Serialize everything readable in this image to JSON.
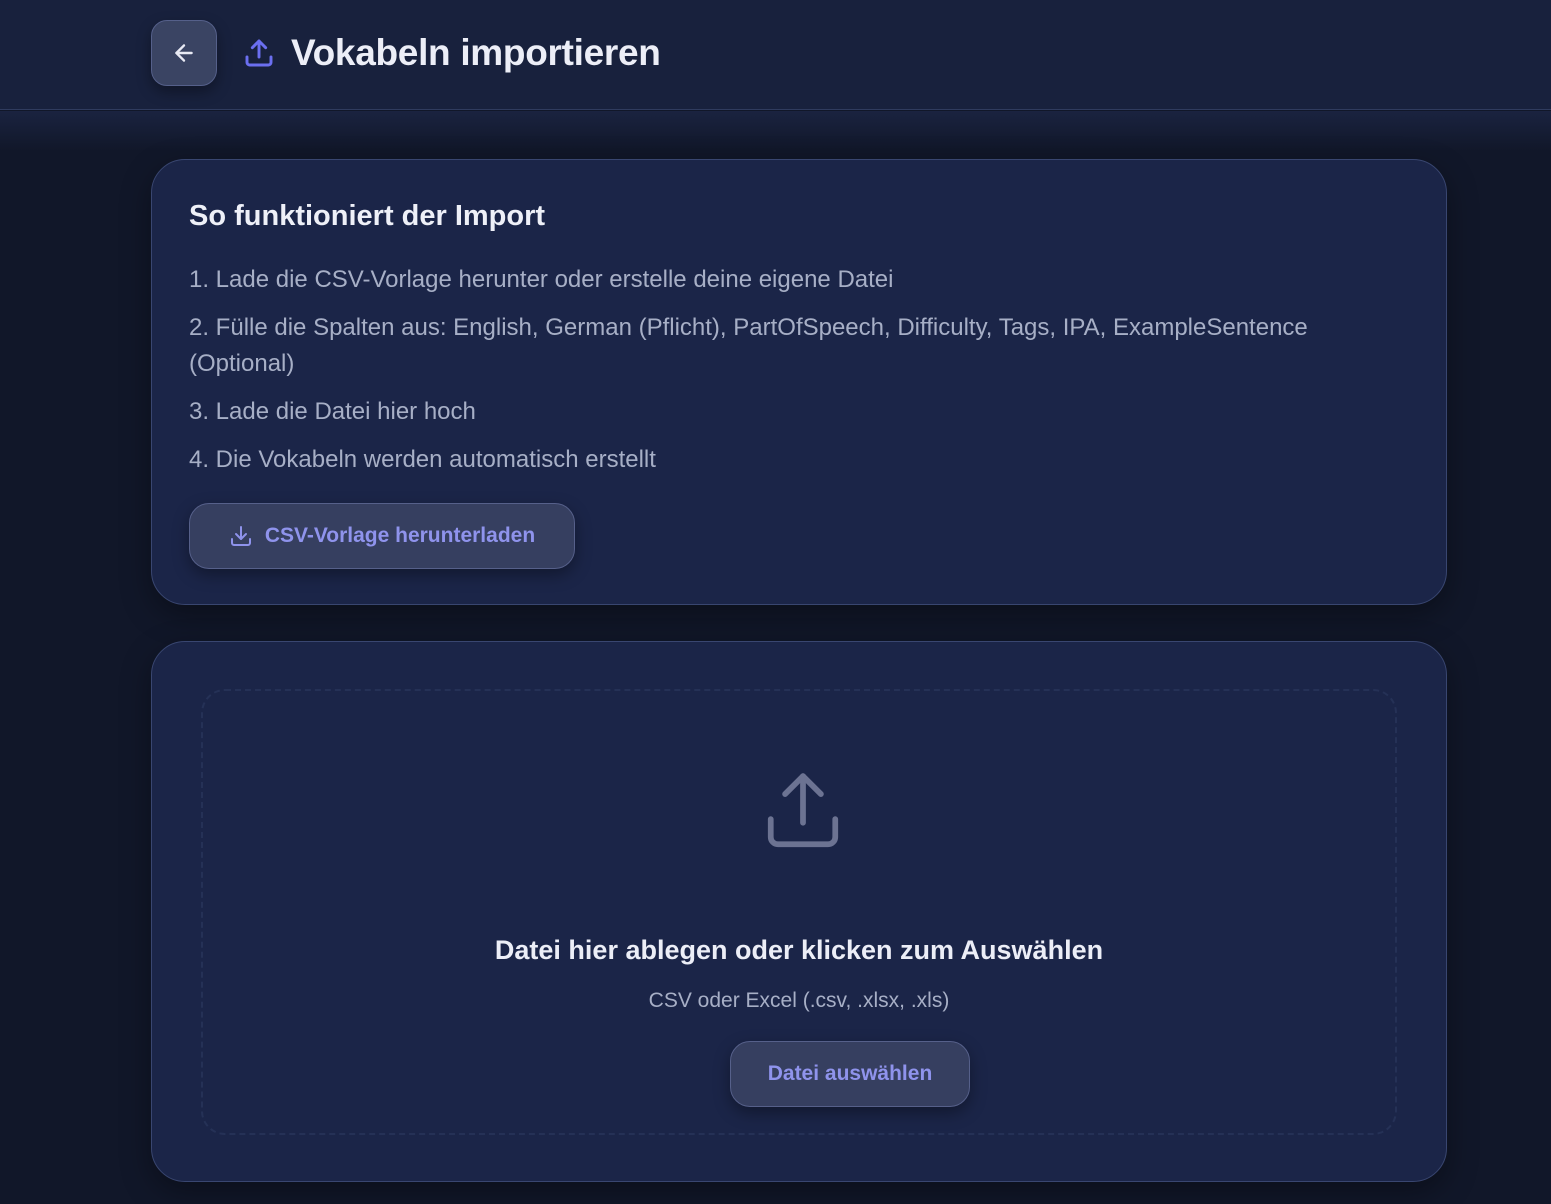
{
  "header": {
    "title": "Vokabeln importieren",
    "back_icon": "arrow-left-icon",
    "title_icon": "upload-icon"
  },
  "info": {
    "title": "So funktioniert der Import",
    "steps": [
      "1. Lade die CSV-Vorlage herunter oder erstelle deine eigene Datei",
      "2. Fülle die Spalten aus: English, German (Pflicht), PartOfSpeech, Difficulty, Tags, IPA, ExampleSentence (Optional)",
      "3. Lade die Datei hier hoch",
      "4. Die Vokabeln werden automatisch erstellt"
    ],
    "download_label": "CSV-Vorlage herunterladen",
    "download_icon": "download-icon"
  },
  "upload": {
    "icon": "upload-icon",
    "title": "Datei hier ablegen oder klicken zum Auswählen",
    "subtitle": "CSV oder Excel (.csv, .xlsx, .xls)",
    "button_label": "Datei auswählen"
  },
  "colors": {
    "background": "#111729",
    "header": "#18213d",
    "card": "#1b2548",
    "accent": "#8f93ec",
    "icon_accent": "#6b6ff0",
    "muted_text": "#a7afc6"
  }
}
